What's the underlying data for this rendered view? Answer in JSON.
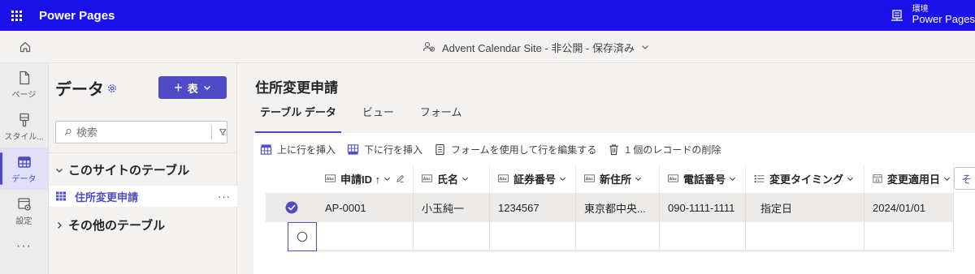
{
  "app": {
    "title": "Power Pages"
  },
  "environment": {
    "label": "環境",
    "name": "Power Pages"
  },
  "site": {
    "info": "Advent Calendar Site - 非公開 - 保存済み"
  },
  "rail": {
    "items": [
      {
        "label": "ページ",
        "icon": "page-icon"
      },
      {
        "label": "スタイル...",
        "icon": "brush-icon"
      },
      {
        "label": "データ",
        "icon": "table-icon"
      },
      {
        "label": "設定",
        "icon": "settings-icon"
      }
    ],
    "more": "···"
  },
  "panel": {
    "title": "データ",
    "new_button": {
      "plus": "+",
      "label": "表"
    },
    "search_placeholder": "検索",
    "section_this_site": "このサイトのテーブル",
    "table_item": "住所変更申請",
    "table_item_more": "···",
    "section_other": "その他のテーブル"
  },
  "main": {
    "title": "住所変更申請",
    "tabs": [
      "テーブル データ",
      "ビュー",
      "フォーム"
    ],
    "commands": [
      {
        "label": "上に行を挿入",
        "icon": "insert-above-icon"
      },
      {
        "label": "下に行を挿入",
        "icon": "insert-below-icon"
      },
      {
        "label": "フォームを使用して行を編集する",
        "icon": "form-icon"
      },
      {
        "label": "1 個のレコードの削除",
        "icon": "trash-icon"
      }
    ],
    "columns": [
      {
        "label": "申請ID ↑",
        "icon": "text-field-icon"
      },
      {
        "label": "氏名",
        "icon": "text-field-icon"
      },
      {
        "label": "証券番号",
        "icon": "text-field-icon"
      },
      {
        "label": "新住所",
        "icon": "text-field-icon"
      },
      {
        "label": "電話番号",
        "icon": "text-field-icon"
      },
      {
        "label": "変更タイミング",
        "icon": "choice-icon"
      },
      {
        "label": "変更適用日",
        "icon": "calendar-icon"
      }
    ],
    "rows": [
      {
        "selected": true,
        "cells": [
          "AP-0001",
          "小玉純一",
          "1234567",
          "東京都中央...",
          "090-1111-1111",
          "指定日",
          "2024/01/01"
        ]
      }
    ],
    "add_column": "そ"
  },
  "colors": {
    "brand_bar": "#1a10e8",
    "accent": "#4f4bc7"
  }
}
